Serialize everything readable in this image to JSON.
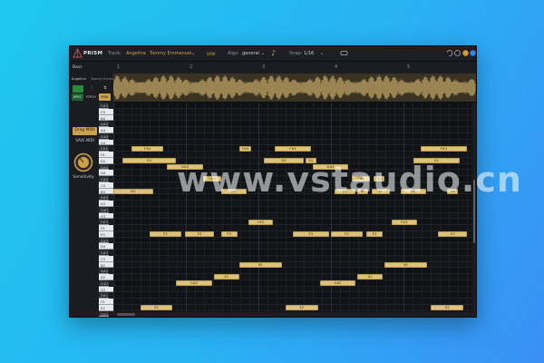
{
  "app": {
    "name": "PRISM"
  },
  "header": {
    "track_label": "Track:",
    "track_name": "Angelina",
    "artist": "Tommy Emmanuel",
    "badge": "DAW",
    "algo_label": "Algo:",
    "algo_value": "general",
    "snap_label": "Snap:",
    "snap_value": "1/16"
  },
  "left": {
    "bass_label": "Bass",
    "track_short": "Angelina",
    "artist_short": "Tommy Emma...",
    "tab_spec": "SPEC",
    "tab_pitch": "PITCH",
    "tab_midi": "MIDI",
    "drag_midi": "Drag MIDI",
    "save_midi": "SAVE MIDI",
    "sensitivity": "Sensitivity"
  },
  "timeline": {
    "markers": [
      "1",
      "2",
      "3",
      "4",
      "5"
    ]
  },
  "keyboard": [
    "C#5",
    "C5",
    "B4",
    "A#4",
    "A4",
    "G#4",
    "G4",
    "F#4",
    "F4",
    "E4",
    "D#4",
    "D4",
    "C#4",
    "C4",
    "B3",
    "A#3",
    "A3",
    "G#3",
    "G3",
    "F#3",
    "F3",
    "E3",
    "D#3",
    "D3",
    "C#3",
    "C3",
    "B2",
    "A#2",
    "A2",
    "G#2",
    "G2",
    "F#2",
    "F2",
    "E2",
    "D#2"
  ],
  "notes": [
    {
      "label": "F#4",
      "row": 7,
      "start": 0.05,
      "len": 0.09
    },
    {
      "label": "F#4",
      "row": 7,
      "start": 0.35,
      "len": 0.035
    },
    {
      "label": "F#4",
      "row": 7,
      "start": 0.45,
      "len": 0.1
    },
    {
      "label": "F#4",
      "row": 7,
      "start": 0.855,
      "len": 0.13
    },
    {
      "label": "E4",
      "row": 9,
      "start": 0.025,
      "len": 0.15
    },
    {
      "label": "D4",
      "row": 9,
      "start": 0.42,
      "len": 0.11
    },
    {
      "label": "E4",
      "row": 9,
      "start": 0.535,
      "len": 0.03
    },
    {
      "label": "E4",
      "row": 9,
      "start": 0.835,
      "len": 0.13
    },
    {
      "label": "D#4",
      "row": 10,
      "start": 0.15,
      "len": 0.1
    },
    {
      "label": "D#4",
      "row": 10,
      "start": 0.555,
      "len": 0.1
    },
    {
      "label": "C#4",
      "row": 12,
      "start": 0.25,
      "len": 0.05
    },
    {
      "label": "C#4",
      "row": 12,
      "start": 0.665,
      "len": 0.05
    },
    {
      "label": "C#4",
      "row": 12,
      "start": 0.725,
      "len": 0.03
    },
    {
      "label": "B3",
      "row": 14,
      "start": 0.0,
      "len": 0.11
    },
    {
      "label": "B3",
      "row": 14,
      "start": 0.3,
      "len": 0.07
    },
    {
      "label": "B3",
      "row": 14,
      "start": 0.615,
      "len": 0.06
    },
    {
      "label": "B3",
      "row": 14,
      "start": 0.68,
      "len": 0.03
    },
    {
      "label": "B3",
      "row": 14,
      "start": 0.72,
      "len": 0.05
    },
    {
      "label": "B3",
      "row": 14,
      "start": 0.8,
      "len": 0.07
    },
    {
      "label": "B3",
      "row": 14,
      "start": 0.93,
      "len": 0.03
    },
    {
      "label": "F#3",
      "row": 19,
      "start": 0.375,
      "len": 0.07
    },
    {
      "label": "F#3",
      "row": 19,
      "start": 0.775,
      "len": 0.07
    },
    {
      "label": "E3",
      "row": 21,
      "start": 0.1,
      "len": 0.09
    },
    {
      "label": "E3",
      "row": 21,
      "start": 0.2,
      "len": 0.08
    },
    {
      "label": "E3",
      "row": 21,
      "start": 0.3,
      "len": 0.045
    },
    {
      "label": "E3",
      "row": 21,
      "start": 0.5,
      "len": 0.1
    },
    {
      "label": "E3",
      "row": 21,
      "start": 0.605,
      "len": 0.09
    },
    {
      "label": "E3",
      "row": 21,
      "start": 0.705,
      "len": 0.045
    },
    {
      "label": "E3",
      "row": 21,
      "start": 0.905,
      "len": 0.08
    },
    {
      "label": "B2",
      "row": 26,
      "start": 0.35,
      "len": 0.12
    },
    {
      "label": "B2",
      "row": 26,
      "start": 0.755,
      "len": 0.12
    },
    {
      "label": "A2",
      "row": 28,
      "start": 0.28,
      "len": 0.07
    },
    {
      "label": "A2",
      "row": 28,
      "start": 0.68,
      "len": 0.07
    },
    {
      "label": "G#2",
      "row": 29,
      "start": 0.175,
      "len": 0.1
    },
    {
      "label": "G#2",
      "row": 29,
      "start": 0.575,
      "len": 0.1
    },
    {
      "label": "E2",
      "row": 33,
      "start": 0.075,
      "len": 0.09
    },
    {
      "label": "E2",
      "row": 33,
      "start": 0.48,
      "len": 0.09
    },
    {
      "label": "E2",
      "row": 33,
      "start": 0.885,
      "len": 0.09
    }
  ],
  "colors": {
    "note": "#dcc27a",
    "accent": "#cfa24a",
    "bg": "#121418"
  },
  "watermark": "www.vstaudio.cn"
}
